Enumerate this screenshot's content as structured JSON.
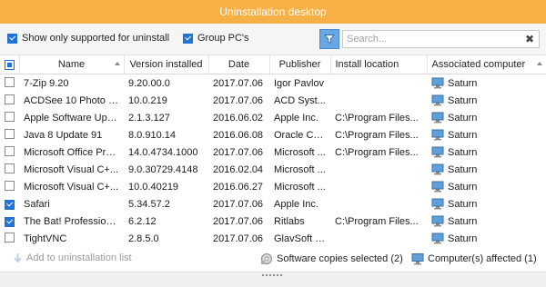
{
  "window": {
    "title": "Uninstallation desktop"
  },
  "options": {
    "show_supported": {
      "label": "Show only supported for uninstall",
      "checked": true
    },
    "group_pcs": {
      "label": "Group PC's",
      "checked": true
    }
  },
  "toolbar": {
    "filter_icon": "filter-icon"
  },
  "search": {
    "placeholder": "Search...",
    "clear_glyph": "✖"
  },
  "table": {
    "columns": [
      "Name",
      "Version installed",
      "Date",
      "Publisher",
      "Install location",
      "Associated computer"
    ],
    "rows": [
      {
        "checked": false,
        "name": "7-Zip 9.20",
        "version": "9.20.00.0",
        "date": "2017.07.06",
        "publisher": "Igor Pavlov",
        "location": "",
        "computer": "Saturn"
      },
      {
        "checked": false,
        "name": "ACDSee 10 Photo M...",
        "version": "10.0.219",
        "date": "2017.07.06",
        "publisher": "ACD Syst...",
        "location": "",
        "computer": "Saturn"
      },
      {
        "checked": false,
        "name": "Apple Software Upd...",
        "version": "2.1.3.127",
        "date": "2016.06.02",
        "publisher": "Apple Inc.",
        "location": "C:\\Program Files...",
        "computer": "Saturn"
      },
      {
        "checked": false,
        "name": "Java 8 Update 91",
        "version": "8.0.910.14",
        "date": "2016.06.08",
        "publisher": "Oracle Co...",
        "location": "C:\\Program Files...",
        "computer": "Saturn"
      },
      {
        "checked": false,
        "name": "Microsoft Office Pro...",
        "version": "14.0.4734.1000",
        "date": "2017.07.06",
        "publisher": "Microsoft ...",
        "location": "C:\\Program Files...",
        "computer": "Saturn"
      },
      {
        "checked": false,
        "name": "Microsoft Visual C+...",
        "version": "9.0.30729.4148",
        "date": "2016.02.04",
        "publisher": "Microsoft ...",
        "location": "",
        "computer": "Saturn"
      },
      {
        "checked": false,
        "name": "Microsoft Visual C+...",
        "version": "10.0.40219",
        "date": "2016.06.27",
        "publisher": "Microsoft ...",
        "location": "",
        "computer": "Saturn"
      },
      {
        "checked": true,
        "name": "Safari",
        "version": "5.34.57.2",
        "date": "2017.07.06",
        "publisher": "Apple Inc.",
        "location": "",
        "computer": "Saturn"
      },
      {
        "checked": true,
        "name": "The Bat! Profession...",
        "version": "6.2.12",
        "date": "2017.07.06",
        "publisher": "Ritlabs",
        "location": "C:\\Program Files...",
        "computer": "Saturn"
      },
      {
        "checked": false,
        "name": "TightVNC",
        "version": "2.8.5.0",
        "date": "2017.07.06",
        "publisher": "GlavSoft L...",
        "location": "",
        "computer": "Saturn"
      }
    ]
  },
  "footer": {
    "add_label": "Add to uninstallation list",
    "copies_label": "Software copies selected (2)",
    "computers_label": "Computer(s) affected (1)"
  },
  "colors": {
    "titlebar": "#f7b045",
    "accent": "#1f73d6"
  }
}
